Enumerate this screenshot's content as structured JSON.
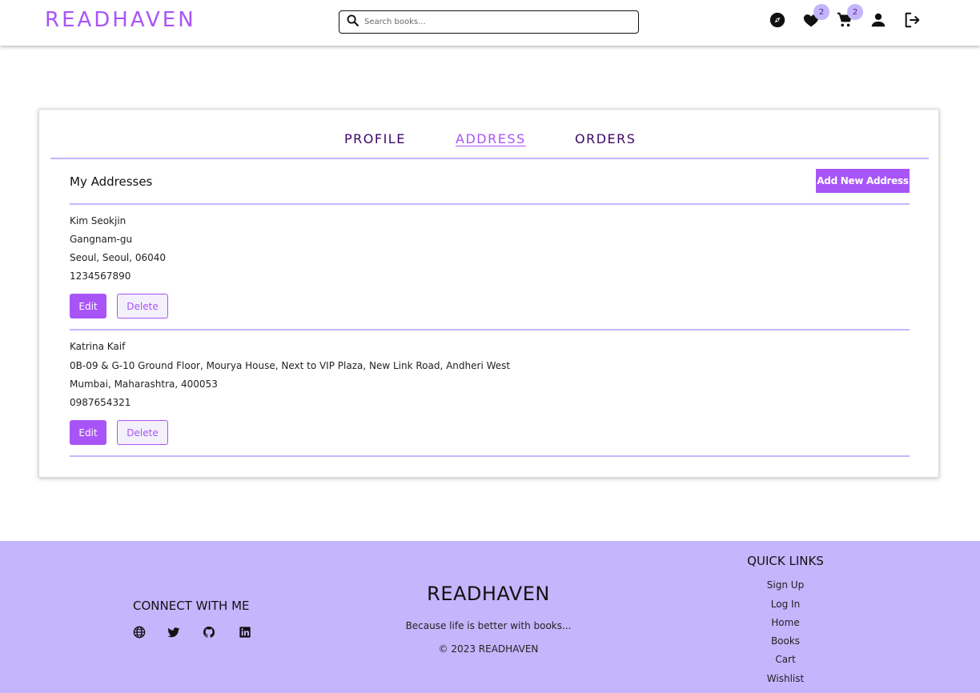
{
  "header": {
    "logo": "READHAVEN",
    "search_placeholder": "Search books...",
    "wishlist_count": "2",
    "cart_count": "2",
    "icons": [
      "explore-icon",
      "heart-icon",
      "cart-icon",
      "user-icon",
      "logout-icon"
    ]
  },
  "tabs": [
    {
      "label": "PROFILE",
      "active": false
    },
    {
      "label": "ADDRESS",
      "active": true
    },
    {
      "label": "ORDERS",
      "active": false
    }
  ],
  "addresses_section": {
    "title": "My Addresses",
    "add_button": "Add New Address",
    "edit_label": "Edit",
    "delete_label": "Delete",
    "addresses": [
      {
        "name": "Kim Seokjin",
        "street": "Gangnam-gu",
        "city_line": "Seoul, Seoul, 06040",
        "phone": "1234567890"
      },
      {
        "name": "Katrina Kaif",
        "street": "0B-09 & G-10 Ground Floor, Mourya House, Next to VIP Plaza, New Link Road, Andheri West",
        "city_line": "Mumbai, Maharashtra, 400053",
        "phone": "0987654321"
      }
    ]
  },
  "footer": {
    "connect_title": "CONNECT WITH ME",
    "social_icons": [
      "globe-icon",
      "twitter-icon",
      "github-icon",
      "linkedin-icon"
    ],
    "brand": "READHAVEN",
    "tagline": "Because life is better with books...",
    "copyright": "© 2023 READHAVEN",
    "quick_links_title": "QUICK LINKS",
    "quick_links": [
      "Sign Up",
      "Log In",
      "Home",
      "Books",
      "Cart",
      "Wishlist"
    ]
  },
  "colors": {
    "accent": "#a855f7",
    "footer_bg": "#c4b5fd",
    "tab_text": "#3b0764"
  }
}
